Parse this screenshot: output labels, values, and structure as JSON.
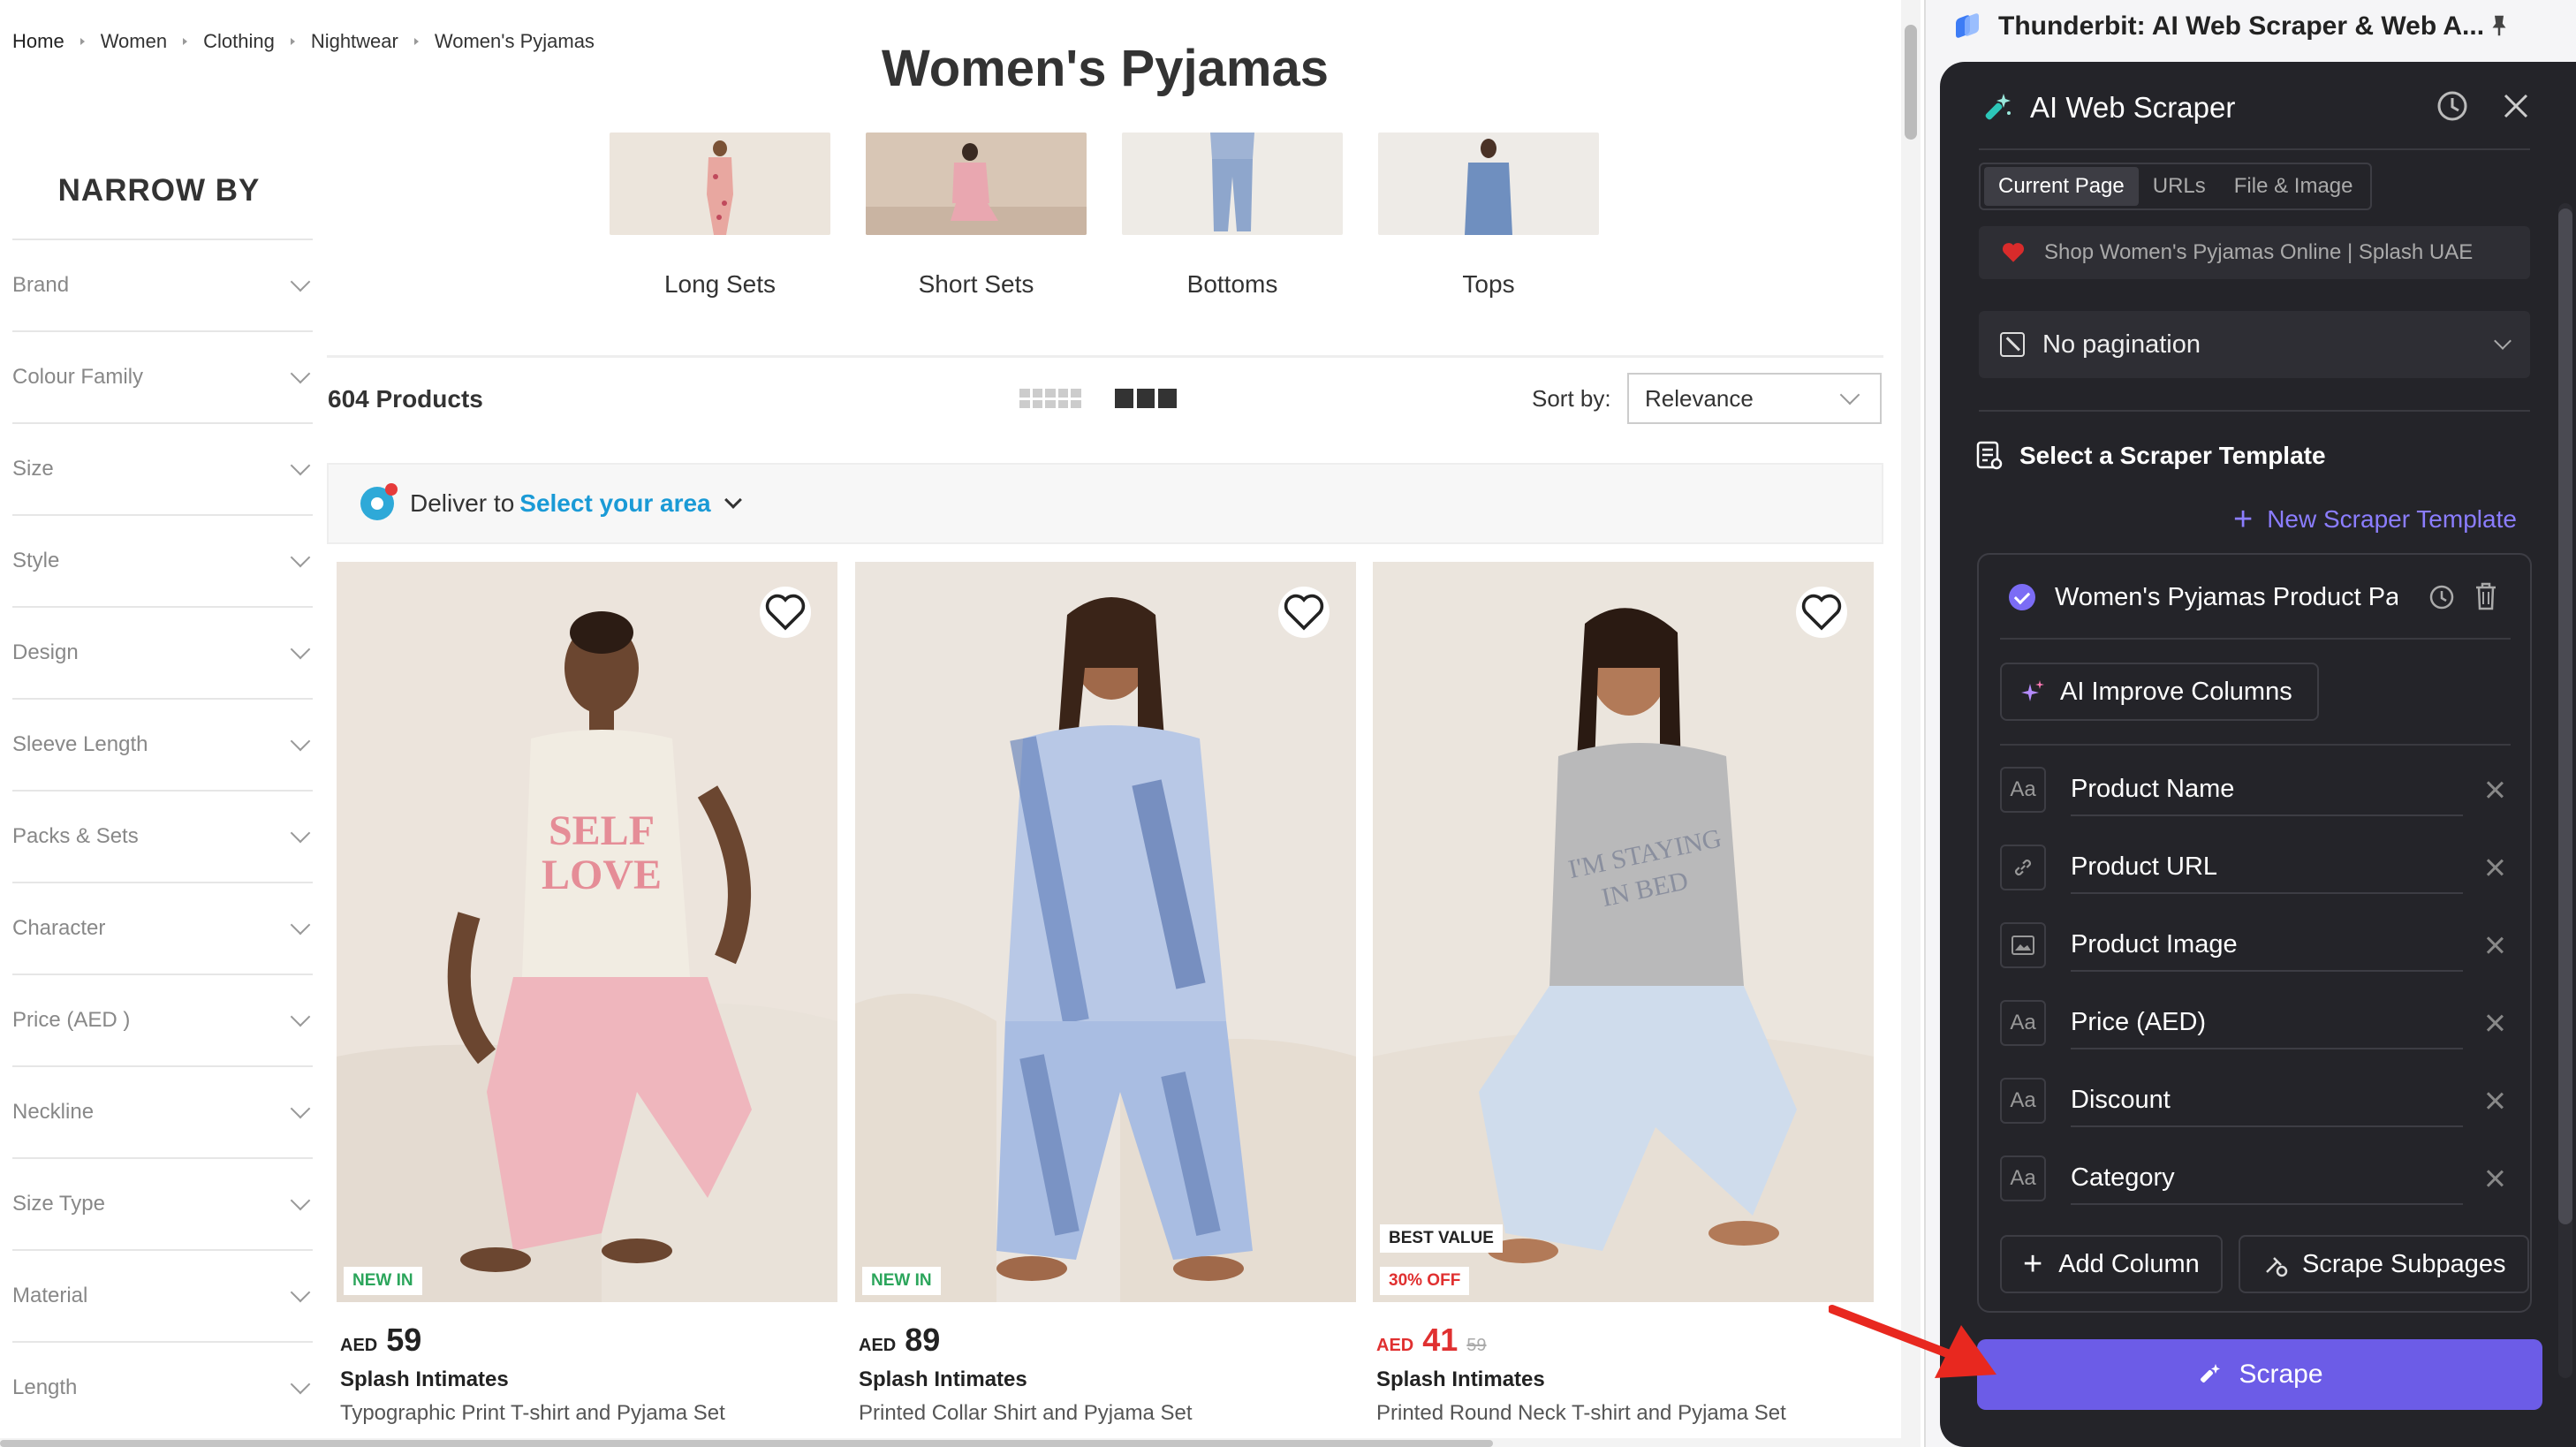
{
  "breadcrumb": [
    "Home",
    "Women",
    "Clothing",
    "Nightwear",
    "Women's Pyjamas"
  ],
  "page_title": "Women's Pyjamas",
  "narrow_by": "NARROW BY",
  "filters": [
    "Brand",
    "Colour Family",
    "Size",
    "Style",
    "Design",
    "Sleeve Length",
    "Packs & Sets",
    "Character",
    "Price (AED )",
    "Neckline",
    "Size Type",
    "Material",
    "Length"
  ],
  "categories": [
    "Long Sets",
    "Short Sets",
    "Bottoms",
    "Tops"
  ],
  "product_count": "604 Products",
  "sort": {
    "label": "Sort by:",
    "value": "Relevance"
  },
  "deliver": {
    "text": "Deliver to",
    "link": "Select your area"
  },
  "products": [
    {
      "badge": "NEW IN",
      "currency": "AED",
      "price": "59",
      "brand": "Splash Intimates",
      "name": "Typographic Print T-shirt and Pyjama Set"
    },
    {
      "badge": "NEW IN",
      "currency": "AED",
      "price": "89",
      "brand": "Splash Intimates",
      "name": "Printed Collar Shirt and Pyjama Set"
    },
    {
      "badge": "BEST VALUE",
      "badge2": "30% OFF",
      "currency": "AED",
      "price": "41",
      "was": "59",
      "brand": "Splash Intimates",
      "name": "Printed Round Neck T-shirt and Pyjama Set"
    }
  ],
  "panel": {
    "ext_title": "Thunderbit: AI Web Scraper & Web A...",
    "title": "AI Web Scraper",
    "tabs": [
      "Current Page",
      "URLs",
      "File & Image"
    ],
    "page_name": "Shop Women's Pyjamas Online | Splash UAE",
    "pagination": "No pagination",
    "section_title": "Select a Scraper Template",
    "new_template": "New Scraper Template",
    "template_name": "Women's Pyjamas Product Page",
    "improve": "AI Improve Columns",
    "columns": [
      {
        "icon": "text-icon",
        "name": "Product Name"
      },
      {
        "icon": "link-icon",
        "name": "Product URL"
      },
      {
        "icon": "image-icon",
        "name": "Product Image"
      },
      {
        "icon": "text-icon",
        "name": "Price (AED)"
      },
      {
        "icon": "text-icon",
        "name": "Discount"
      },
      {
        "icon": "text-icon",
        "name": "Category"
      }
    ],
    "add_column": "Add Column",
    "scrape_subpages": "Scrape Subpages",
    "scrape": "Scrape"
  },
  "colors": {
    "accent": "#6c5ce7",
    "link": "#1a9ad6",
    "sale": "#e03030",
    "new": "#2ba55b",
    "panel_bg": "#242429"
  }
}
